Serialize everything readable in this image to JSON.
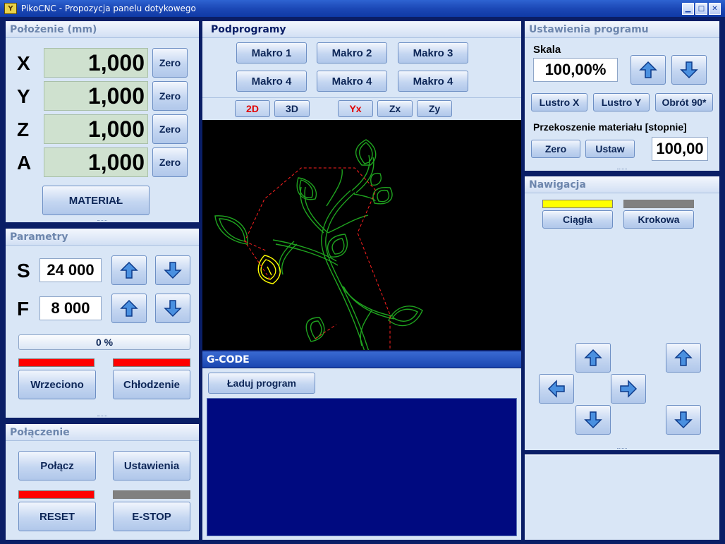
{
  "window": {
    "title": "PikoCNC - Propozycja panelu dotykowego",
    "logo": "Y"
  },
  "position": {
    "title": "Położenie (mm)",
    "axes": [
      {
        "letter": "X",
        "value": "1,000",
        "zero": "Zero"
      },
      {
        "letter": "Y",
        "value": "1,000",
        "zero": "Zero"
      },
      {
        "letter": "Z",
        "value": "1,000",
        "zero": "Zero"
      },
      {
        "letter": "A",
        "value": "1,000",
        "zero": "Zero"
      }
    ],
    "material_label": "MATERIAŁ"
  },
  "params": {
    "title": "Parametry",
    "s_letter": "S",
    "s_value": "24 000",
    "f_letter": "F",
    "f_value": "8 000",
    "progress_text": "0 %",
    "progress": 0,
    "spindle_label": "Wrzeciono",
    "cooling_label": "Chłodzenie",
    "indicator_on_color": "#ff0000"
  },
  "connection": {
    "title": "Połączenie",
    "connect_label": "Połącz",
    "settings_label": "Ustawienia",
    "reset_label": "RESET",
    "estop_label": "E-STOP",
    "indicator_red": "#ff0000",
    "indicator_gray": "#808080"
  },
  "subprograms": {
    "title": "Podprogramy",
    "macros": [
      "Makro 1",
      "Makro 2",
      "Makro 3",
      "Makro 4",
      "Makro 4",
      "Makro 4"
    ],
    "view_2d": "2D",
    "view_3d": "3D",
    "plane_yx": "Yx",
    "plane_zx": "Zx",
    "plane_zy": "Zy"
  },
  "gcode": {
    "title": "G-CODE",
    "load_label": "Ładuj program"
  },
  "program_settings": {
    "title": "Ustawienia programu",
    "scale_label": "Skala",
    "scale_value": "100,00%",
    "mirror_x": "Lustro X",
    "mirror_y": "Lustro Y",
    "rotate": "Obrót 90*",
    "skew_label": "Przekoszenie materiału [stopnie]",
    "zero_label": "Zero",
    "set_label": "Ustaw",
    "skew_value": "100,00"
  },
  "navigation": {
    "title": "Nawigacja",
    "continuous_label": "Ciągła",
    "step_label": "Krokowa",
    "continuous_color": "#ffff00",
    "step_color": "#808080"
  },
  "colors": {
    "accent": "#0a1e66",
    "panel": "#d9e6f6",
    "toolpath": "#1fa31f",
    "rapid": "#ff2020",
    "highlight": "#ffff00"
  }
}
